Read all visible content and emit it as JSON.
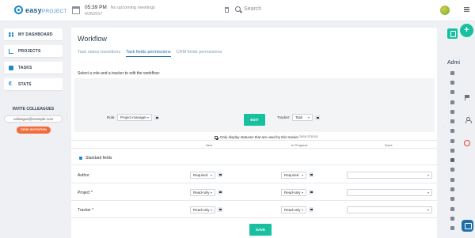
{
  "header": {
    "logo": {
      "brand": "easy",
      "brand_suffix": "PROJECT"
    },
    "time": "05:39 PM",
    "meetings": "No upcoming meetings",
    "date": "4/26/2017",
    "search_placeholder": "Search"
  },
  "sidebar": {
    "items": [
      {
        "label": "MY DASHBOARD"
      },
      {
        "label": "PROJECTS"
      },
      {
        "label": "TASKS"
      },
      {
        "label": "STATS"
      }
    ],
    "invite": {
      "title": "INVITE COLLEAGUES",
      "email_placeholder": "colleague@example.com",
      "send_label": "SEND INVITATION"
    }
  },
  "main": {
    "title": "Workflow",
    "tabs": [
      {
        "label": "Task status transitions",
        "active": false
      },
      {
        "label": "Task fields permissions",
        "active": true
      },
      {
        "label": "CRM fields permissions",
        "active": false
      }
    ],
    "instruction": "Select a role and a tracker to edit the workflow:",
    "filter": {
      "role_label": "Role:",
      "role_value": "Project manager",
      "tracker_label": "Tracker:",
      "tracker_value": "Task",
      "only_used_label": "Only display statuses that are used by this tracker",
      "edit_label": "EDIT"
    },
    "table": {
      "status_group": "TASK STATUS",
      "columns": [
        "New",
        "In Progress",
        "Done"
      ],
      "section_label": "Standard fields",
      "rows": [
        {
          "label": "Author",
          "new": "Required",
          "in_progress": "Required"
        },
        {
          "label": "Project *",
          "new": "Read-only",
          "in_progress": "Read-only"
        },
        {
          "label": "Tracker *",
          "new": "Read-only",
          "in_progress": "Read-only"
        }
      ]
    },
    "save_label": "SAVE"
  },
  "right_panel": {
    "admin_label": "Admi"
  },
  "colors": {
    "accent": "#18c0a0",
    "brand_blue": "#1e88c8",
    "invite_orange": "#f26b3a",
    "alarm_red": "#e0463a"
  },
  "icons": [
    "calendar-icon",
    "trash-icon",
    "search-icon",
    "menu-icon",
    "dashboard-icon",
    "projects-icon",
    "tasks-icon",
    "stats-icon",
    "flag-icon",
    "person-icon",
    "alarm-icon",
    "chat-icon",
    "plus-icon"
  ]
}
